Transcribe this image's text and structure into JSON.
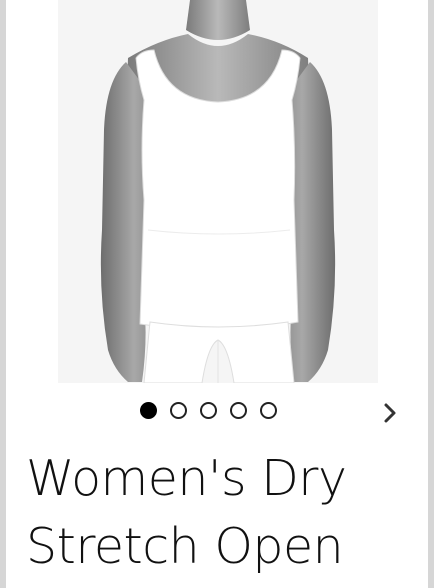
{
  "product": {
    "title": "Women's Dry Stretch Open",
    "image_alt": "White sleeveless tank top on grey mannequin"
  },
  "carousel": {
    "slide_count": 5,
    "active_index": 0
  },
  "icons": {
    "next": "chevron-right-icon"
  },
  "colors": {
    "background": "#ffffff",
    "frame": "#d6d6d6",
    "dot_active": "#000000",
    "garment": "#ffffff",
    "mannequin": "#9a9a9a"
  }
}
